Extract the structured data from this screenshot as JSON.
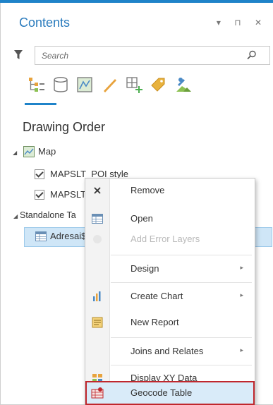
{
  "pane": {
    "title": "Contents",
    "controls": "▾ ⊓ ✕",
    "search_placeholder": "Search"
  },
  "section_title": "Drawing Order",
  "tree": {
    "map_label": "Map",
    "layer1_label": "MAPSLT_POI style",
    "layer2_label": "MAPSLT_st",
    "standalone_label": "Standalone Ta",
    "table_label": "Adresai$"
  },
  "context_menu": {
    "items": [
      {
        "label": "Remove",
        "icon": "close-icon"
      },
      {
        "label": "Open",
        "icon": "table-icon"
      },
      {
        "label": "Add Error Layers",
        "icon": "error-layers-icon",
        "disabled": true
      },
      {
        "label": "Design",
        "submenu": true
      },
      {
        "label": "Create Chart",
        "icon": "chart-icon",
        "submenu": true
      },
      {
        "label": "New Report",
        "icon": "report-icon"
      },
      {
        "label": "Joins and Relates",
        "submenu": true
      },
      {
        "label": "Display XY Data",
        "icon": "xy-data-icon"
      },
      {
        "label": "Geocode Table",
        "icon": "geocode-icon",
        "highlighted": true
      }
    ]
  },
  "colors": {
    "accent": "#1f83c9",
    "selection": "#cfe6f7",
    "highlight_border": "#c0272d"
  }
}
